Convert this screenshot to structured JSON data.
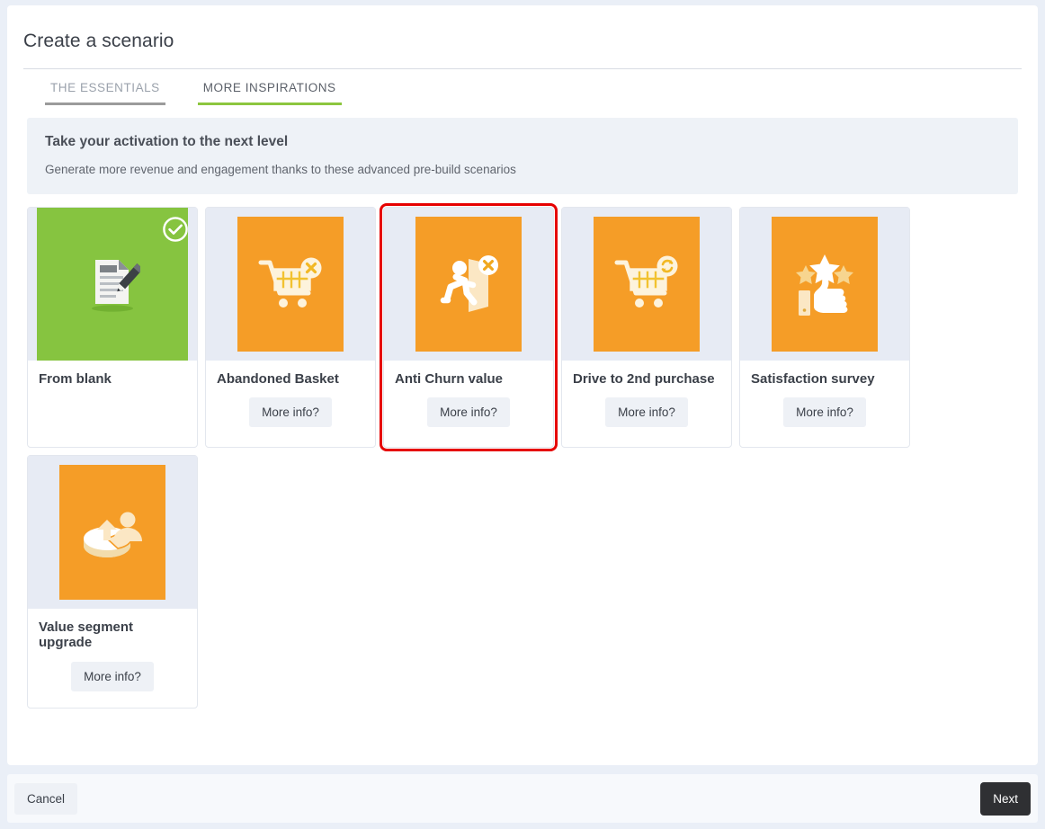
{
  "modal": {
    "title": "Create a scenario",
    "tabs": [
      {
        "label": "THE ESSENTIALS",
        "active": false
      },
      {
        "label": "MORE INSPIRATIONS",
        "active": true
      }
    ],
    "banner": {
      "title": "Take your activation to the next level",
      "subtitle": "Generate more revenue and engagement thanks to these advanced pre-build scenarios"
    },
    "cards": [
      {
        "title": "From blank",
        "icon": "document-pencil-icon",
        "thumb_color": "#86c440",
        "selected": true,
        "highlighted": false,
        "has_more_info": false,
        "more_info_label": "More info?"
      },
      {
        "title": "Abandoned Basket",
        "icon": "cart-cancel-icon",
        "thumb_color": "#f59d27",
        "selected": false,
        "highlighted": false,
        "has_more_info": true,
        "more_info_label": "More info?"
      },
      {
        "title": "Anti Churn value",
        "icon": "exit-running-cancel-icon",
        "thumb_color": "#f59d27",
        "selected": false,
        "highlighted": true,
        "has_more_info": true,
        "more_info_label": "More info?"
      },
      {
        "title": "Drive to 2nd purchase",
        "icon": "cart-repeat-icon",
        "thumb_color": "#f59d27",
        "selected": false,
        "highlighted": false,
        "has_more_info": true,
        "more_info_label": "More info?"
      },
      {
        "title": "Satisfaction survey",
        "icon": "thumbs-up-stars-icon",
        "thumb_color": "#f59d27",
        "selected": false,
        "highlighted": false,
        "has_more_info": true,
        "more_info_label": "More info?"
      },
      {
        "title": "Value segment upgrade",
        "icon": "pie-chart-person-icon",
        "thumb_color": "#f59d27",
        "selected": false,
        "highlighted": false,
        "has_more_info": true,
        "more_info_label": "More info?"
      }
    ]
  },
  "footer": {
    "cancel_label": "Cancel",
    "next_label": "Next"
  },
  "colors": {
    "accent_green": "#8cc63e",
    "thumb_orange": "#f59d27",
    "thumb_green": "#86c440",
    "highlight_red": "#e60000",
    "next_button": "#2f3033",
    "page_bg": "#eaeff7"
  }
}
